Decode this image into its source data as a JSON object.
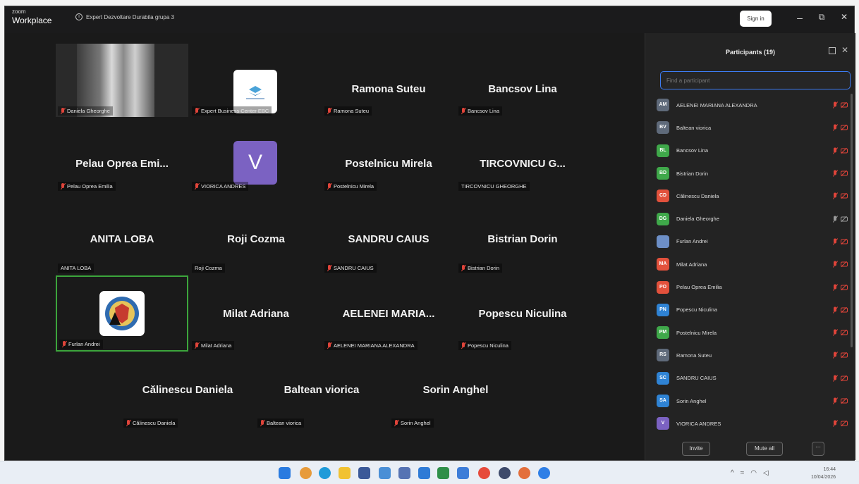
{
  "app": {
    "logo_top": "zoom",
    "logo_bottom": "Workplace",
    "meeting_title": "Expert Dezvoltare Durabila grupa 3",
    "sign_in": "Sign in",
    "win_min": "–",
    "win_max": "⧉",
    "win_close": "✕"
  },
  "tiles": [
    {
      "big": "",
      "label": "Daniela Gheorghe",
      "muted": true
    },
    {
      "big": "",
      "label": "Expert Business Center EBC",
      "muted": true
    },
    {
      "big": "Ramona Suteu",
      "label": "Ramona Suteu",
      "muted": true
    },
    {
      "big": "Bancsov  Lina",
      "label": "Bancsov  Lina",
      "muted": true
    },
    {
      "big": "Pelau  Oprea  Emi...",
      "label": "Pelau Oprea Emilia",
      "muted": true
    },
    {
      "big": "V",
      "label": "VIORICA ANDRES",
      "muted": true
    },
    {
      "big": "Postelnicu Mirela",
      "label": "Postelnicu Mirela",
      "muted": true
    },
    {
      "big": "TIRCOVNICU  G...",
      "label": "TIRCOVNICU GHEORGHE",
      "muted": false
    },
    {
      "big": "ANITA LOBA",
      "label": "ANITA LOBA",
      "muted": false
    },
    {
      "big": "Roji Cozma",
      "label": "Roji Cozma",
      "muted": false
    },
    {
      "big": "SANDRU CAIUS",
      "label": "SANDRU CAIUS",
      "muted": true
    },
    {
      "big": "Bistrian Dorin",
      "label": "Bistrian Dorin",
      "muted": true
    },
    {
      "big": "",
      "label": "Furlan Andrei",
      "muted": true
    },
    {
      "big": "Milat Adriana",
      "label": "Milat Adriana",
      "muted": true
    },
    {
      "big": "AELENEI  MARIA...",
      "label": "AELENEI MARIANA ALEXANDRA",
      "muted": true
    },
    {
      "big": "Popescu Niculina",
      "label": "Popescu Niculina",
      "muted": true
    },
    {
      "big": "Călinescu Daniela",
      "label": "Călinescu Daniela",
      "muted": true
    },
    {
      "big": "Baltean viorica",
      "label": "Baltean viorica",
      "muted": true
    },
    {
      "big": "Sorin  Anghel",
      "label": "Sorin  Anghel",
      "muted": true
    }
  ],
  "panel": {
    "title": "Participants (19)",
    "search_placeholder": "Find a participant",
    "invite": "Invite",
    "mute_all": "Mute all",
    "more": "···",
    "participants": [
      {
        "initials": "AM",
        "name": "AELENEI MARIANA ALEXANDRA",
        "color": "#5f6a7a"
      },
      {
        "initials": "BV",
        "name": "Baltean viorica",
        "color": "#5f6a7a"
      },
      {
        "initials": "BL",
        "name": "Bancsov  Lina",
        "color": "#3fa84a"
      },
      {
        "initials": "BD",
        "name": "Bistrian Dorin",
        "color": "#3fa84a"
      },
      {
        "initials": "CD",
        "name": "Călinescu Daniela",
        "color": "#e2513c"
      },
      {
        "initials": "DG",
        "name": "Daniela Gheorghe",
        "color": "#3fa84a"
      },
      {
        "initials": "",
        "name": "Furlan Andrei",
        "color": "#6d8fc7"
      },
      {
        "initials": "MA",
        "name": "Milat Adriana",
        "color": "#e2513c"
      },
      {
        "initials": "PO",
        "name": "Pelau Oprea Emilia",
        "color": "#e2513c"
      },
      {
        "initials": "PN",
        "name": "Popescu Niculina",
        "color": "#2f83d4"
      },
      {
        "initials": "PM",
        "name": "Postelnicu Mirela",
        "color": "#3fa84a"
      },
      {
        "initials": "RS",
        "name": "Ramona Suteu",
        "color": "#5f6a7a"
      },
      {
        "initials": "SC",
        "name": "SANDRU CAIUS",
        "color": "#2f83d4"
      },
      {
        "initials": "SA",
        "name": "Sorin  Anghel",
        "color": "#2f83d4"
      },
      {
        "initials": "V",
        "name": "VIORICA ANDRES",
        "color": "#7b62c2"
      }
    ]
  },
  "taskbar": {
    "time": "16:44",
    "date": "10/04/2026"
  }
}
